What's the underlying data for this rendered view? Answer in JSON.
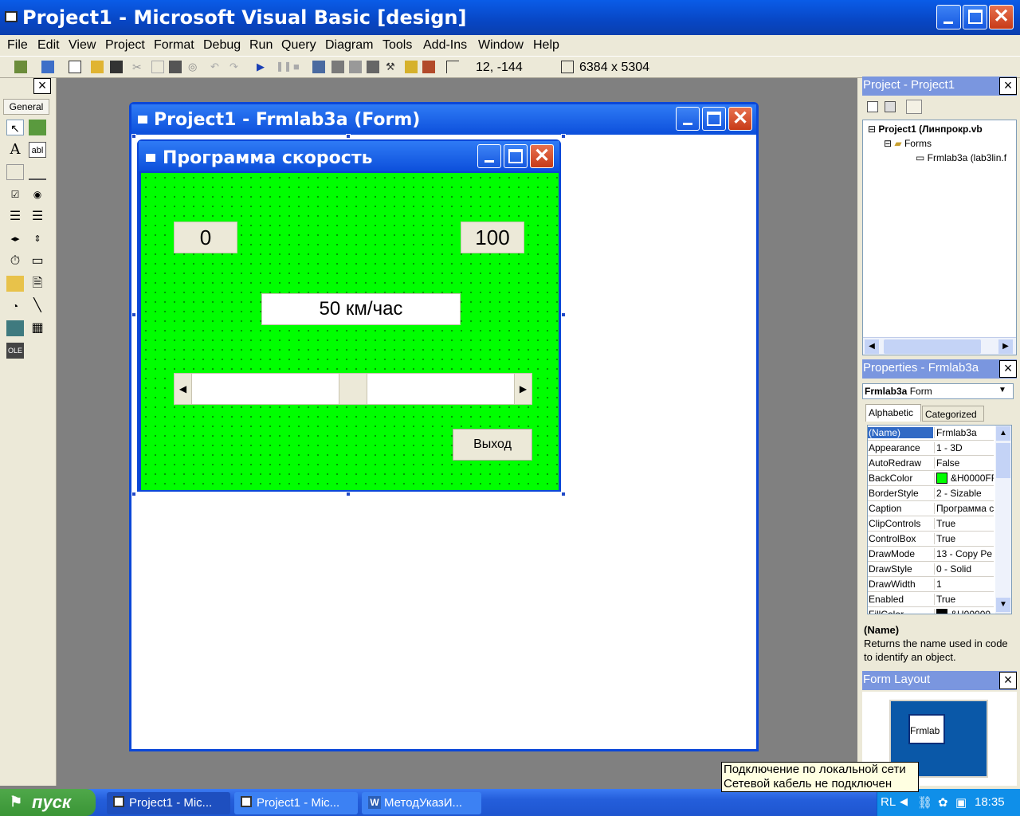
{
  "app": {
    "title": "Project1 - Microsoft Visual Basic [design]"
  },
  "menu": [
    "File",
    "Edit",
    "View",
    "Project",
    "Format",
    "Debug",
    "Run",
    "Query",
    "Diagram",
    "Tools",
    "Add-Ins",
    "Window",
    "Help"
  ],
  "toolbar": {
    "position": "12, -144",
    "size": "6384 x 5304"
  },
  "toolbox": {
    "tab": "General",
    "close": "×"
  },
  "form_window": {
    "title": "Project1 - Frmlab3a (Form)"
  },
  "designer": {
    "title": "Программа скорость",
    "back_color": "#00ff00",
    "label_min": "0",
    "label_max": "100",
    "speed_text": "50 км/час",
    "scroll_level": 0.5,
    "exit_button": "Выход"
  },
  "project_pane": {
    "title": "Project - Project1",
    "close": "×",
    "root": "Project1 (Линпрокр.vb",
    "folder": "Forms",
    "form_item": "Frmlab3a (lab3lin.f"
  },
  "properties_pane": {
    "title": "Properties - Frmlab3a",
    "close": "×",
    "object_name": "Frmlab3a",
    "object_type": "Form",
    "tab_alpha": "Alphabetic",
    "tab_cat": "Categorized",
    "rows": [
      {
        "k": "(Name)",
        "v": "Frmlab3a"
      },
      {
        "k": "Appearance",
        "v": "1 - 3D"
      },
      {
        "k": "AutoRedraw",
        "v": "False"
      },
      {
        "k": "BackColor",
        "v": "&H0000FF"
      },
      {
        "k": "BorderStyle",
        "v": "2 - Sizable"
      },
      {
        "k": "Caption",
        "v": "Программа с"
      },
      {
        "k": "ClipControls",
        "v": "True"
      },
      {
        "k": "ControlBox",
        "v": "True"
      },
      {
        "k": "DrawMode",
        "v": "13 - Copy Pe"
      },
      {
        "k": "DrawStyle",
        "v": "0 - Solid"
      },
      {
        "k": "DrawWidth",
        "v": "1"
      },
      {
        "k": "Enabled",
        "v": "True"
      },
      {
        "k": "FillColor",
        "v": "&H00000"
      }
    ],
    "desc_title": "(Name)",
    "desc_text": "Returns the name used in code to identify an object."
  },
  "form_layout": {
    "title": "Form Layout",
    "close": "×",
    "thumb_label": "Frmlab"
  },
  "taskbar": {
    "start": "пуск",
    "tasks": [
      "Project1 - Mic...",
      "Project1 - Mic...",
      "МетодУказИ..."
    ],
    "lang": "RL",
    "time": "18:35"
  },
  "tooltip": {
    "line1": "Подключение по локальной сети",
    "line2": "Сетевой кабель не подключен"
  }
}
